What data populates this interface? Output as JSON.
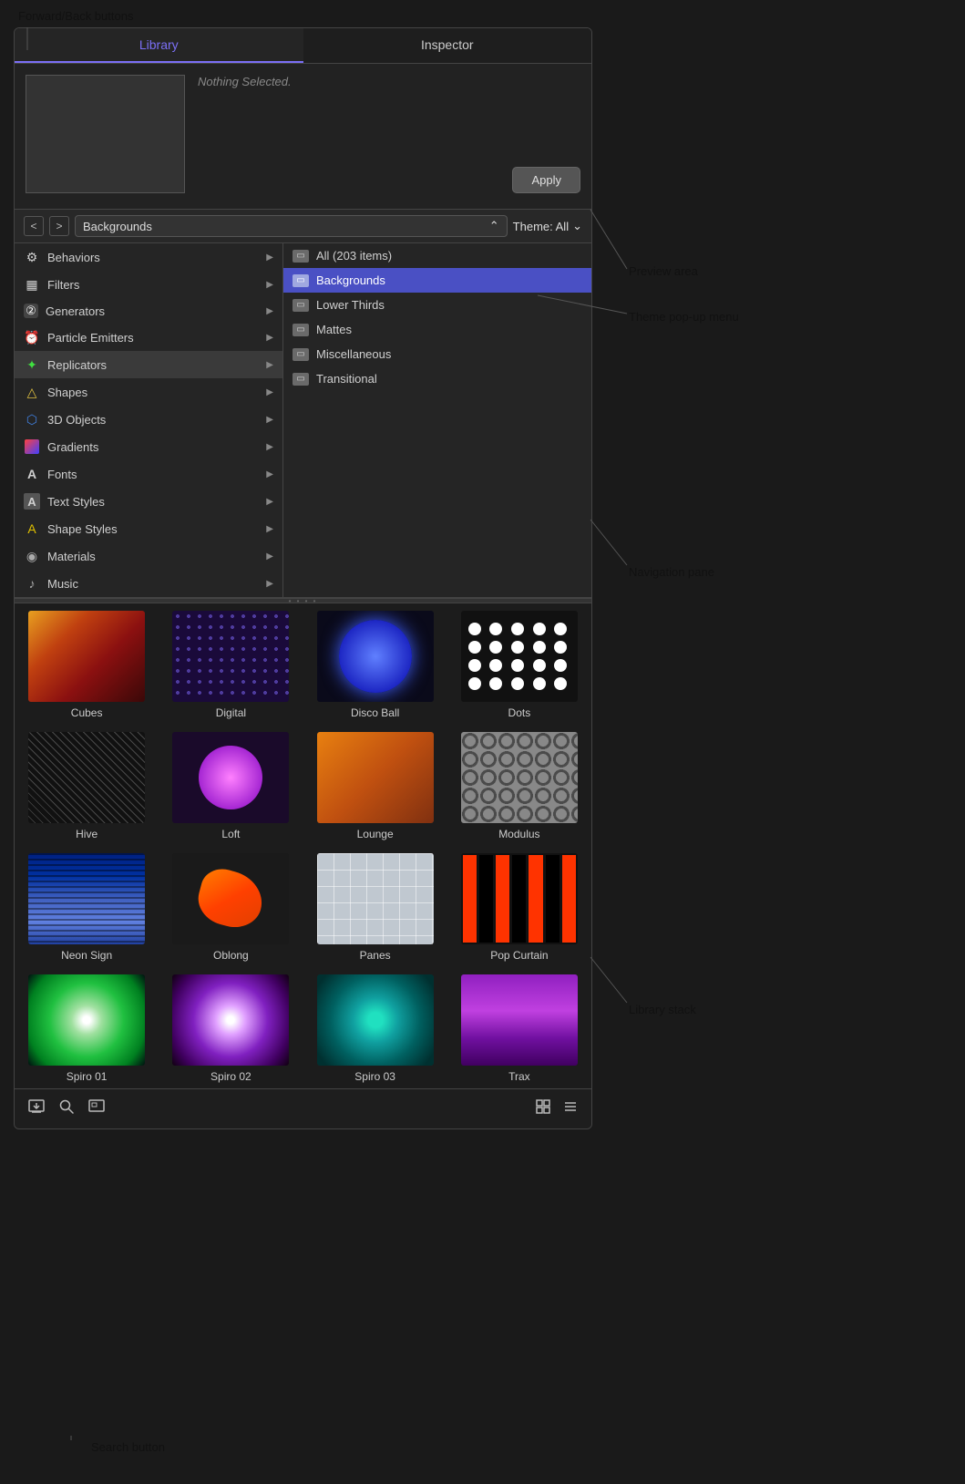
{
  "annotations": {
    "forward_back": "Forward/Back buttons",
    "preview_area": "Preview area",
    "theme_popup": "Theme pop-up menu",
    "navigation_pane": "Navigation pane",
    "library_stack": "Library stack",
    "search_button": "Search button"
  },
  "tabs": {
    "library": "Library",
    "inspector": "Inspector"
  },
  "preview": {
    "nothing_selected": "Nothing Selected.",
    "apply_label": "Apply"
  },
  "breadcrumb": {
    "back_label": "<",
    "forward_label": ">",
    "current": "Backgrounds",
    "theme_label": "Theme: All"
  },
  "nav_items": [
    {
      "id": "behaviors",
      "icon": "⚙",
      "label": "Behaviors"
    },
    {
      "id": "filters",
      "icon": "▦",
      "label": "Filters"
    },
    {
      "id": "generators",
      "icon": "②",
      "label": "Generators"
    },
    {
      "id": "particle-emitters",
      "icon": "⏰",
      "label": "Particle Emitters"
    },
    {
      "id": "replicators",
      "icon": "✦",
      "label": "Replicators",
      "selected": true
    },
    {
      "id": "shapes",
      "icon": "△",
      "label": "Shapes"
    },
    {
      "id": "3d-objects",
      "icon": "⬡",
      "label": "3D Objects"
    },
    {
      "id": "gradients",
      "icon": "▣",
      "label": "Gradients"
    },
    {
      "id": "fonts",
      "icon": "A",
      "label": "Fonts"
    },
    {
      "id": "text-styles",
      "icon": "A",
      "label": "Text Styles"
    },
    {
      "id": "shape-styles",
      "icon": "A",
      "label": "Shape Styles"
    },
    {
      "id": "materials",
      "icon": "◉",
      "label": "Materials"
    },
    {
      "id": "music",
      "icon": "♪",
      "label": "Music"
    }
  ],
  "folder_items": [
    {
      "id": "all",
      "label": "All (203 items)"
    },
    {
      "id": "backgrounds",
      "label": "Backgrounds",
      "selected": true
    },
    {
      "id": "lower-thirds",
      "label": "Lower Thirds"
    },
    {
      "id": "mattes",
      "label": "Mattes"
    },
    {
      "id": "miscellaneous",
      "label": "Miscellaneous"
    },
    {
      "id": "transitional",
      "label": "Transitional"
    }
  ],
  "grid_items": [
    {
      "id": "cubes",
      "label": "Cubes",
      "thumb": "cubes"
    },
    {
      "id": "digital",
      "label": "Digital",
      "thumb": "digital"
    },
    {
      "id": "disco-ball",
      "label": "Disco Ball",
      "thumb": "disco"
    },
    {
      "id": "dots",
      "label": "Dots",
      "thumb": "dots"
    },
    {
      "id": "hive",
      "label": "Hive",
      "thumb": "hive"
    },
    {
      "id": "loft",
      "label": "Loft",
      "thumb": "loft"
    },
    {
      "id": "lounge",
      "label": "Lounge",
      "thumb": "lounge"
    },
    {
      "id": "modulus",
      "label": "Modulus",
      "thumb": "modulus"
    },
    {
      "id": "neon-sign",
      "label": "Neon Sign",
      "thumb": "neon"
    },
    {
      "id": "oblong",
      "label": "Oblong",
      "thumb": "oblong"
    },
    {
      "id": "panes",
      "label": "Panes",
      "thumb": "panes"
    },
    {
      "id": "pop-curtain",
      "label": "Pop Curtain",
      "thumb": "popcurtain"
    },
    {
      "id": "spiro01",
      "label": "Spiro 01",
      "thumb": "spiro1"
    },
    {
      "id": "spiro02",
      "label": "Spiro 02",
      "thumb": "spiro2"
    },
    {
      "id": "spiro03",
      "label": "Spiro 03",
      "thumb": "spiro3"
    },
    {
      "id": "trax",
      "label": "Trax",
      "thumb": "trax"
    }
  ],
  "toolbar": {
    "import_icon": "⊡",
    "search_icon": "⌕",
    "preview_icon": "⊟",
    "grid_icon": "⊞",
    "list_icon": "≡"
  }
}
